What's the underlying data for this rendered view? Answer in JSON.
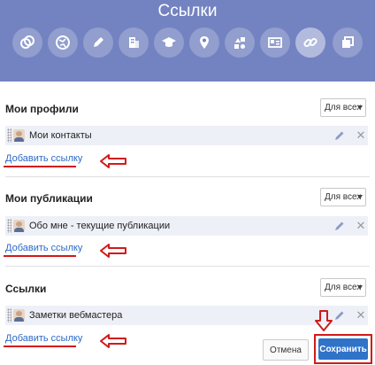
{
  "header": {
    "title": "Ссылки",
    "background": "#7383c1",
    "icons": [
      "link-circle-icon",
      "globe-icon",
      "pencil-icon",
      "building-icon",
      "graduation-cap-icon",
      "location-pin-icon",
      "shapes-icon",
      "id-card-icon",
      "chain-link-icon",
      "copy-icon"
    ]
  },
  "visibility_label": "Для всех",
  "sections": [
    {
      "title": "Мои профили",
      "item": "Мои контакты",
      "add_link": "Добавить ссылку"
    },
    {
      "title": "Мои публикации",
      "item": "Обо мне - текущие публикации",
      "add_link": "Добавить ссылку"
    },
    {
      "title": "Ссылки",
      "item": "Заметки вебмастера",
      "add_link": "Добавить ссылку"
    }
  ],
  "buttons": {
    "cancel": "Отмена",
    "save": "Сохранить"
  },
  "colors": {
    "accent": "#2f73c9",
    "link": "#2a69c7",
    "annotation": "#d11a1a",
    "row": "#eef0f8"
  }
}
